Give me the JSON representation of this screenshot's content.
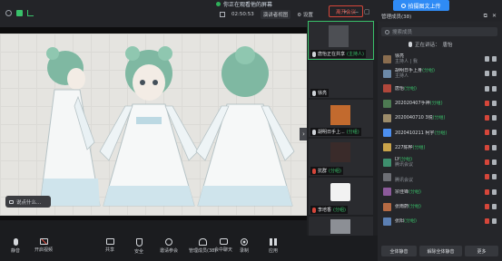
{
  "topbar": {
    "share_banner": "你正在观看他的屏幕",
    "timer": "02:50:53",
    "view_mode": "演讲者视图",
    "settings": "设置"
  },
  "upload_button": "拍摄图文上传",
  "panel_header": {
    "title": "管理成员(38)"
  },
  "stage": {
    "input_placeholder": "说点什么..."
  },
  "videos": [
    {
      "label": "唐怡正在共享",
      "tag": "(主持人)",
      "mic": "on",
      "active": true
    },
    {
      "label": "徐亮",
      "tag": "",
      "mic": "on",
      "active": false
    },
    {
      "label": "胡明日手上...",
      "tag": "(分组)",
      "mic": "on",
      "active": false
    },
    {
      "label": "抗群",
      "tag": "(分组)",
      "mic": "off",
      "active": false
    },
    {
      "label": "李培香",
      "tag": "(分组)",
      "mic": "off",
      "active": false
    },
    {
      "label": "",
      "tag": "",
      "mic": "off",
      "active": false
    }
  ],
  "panel": {
    "search_placeholder": "搜索成员",
    "speaking_label": "正在讲话：",
    "speaking_name": "唐怡",
    "participants": [
      {
        "name": "徐亮",
        "sub": "主持人 | 我",
        "tag": "",
        "color": "#8a6d4f",
        "mic": "on"
      },
      {
        "name": "胡明日手上身",
        "sub": "主持人",
        "tag": "(分组)",
        "color": "#6c89a8",
        "mic": "on"
      },
      {
        "name": "唐怡",
        "sub": "",
        "tag": "(分组)",
        "color": "#b0473b",
        "mic": "on"
      },
      {
        "name": "202020407手神",
        "sub": "",
        "tag": "(分组)",
        "color": "#4d7a52",
        "mic": "off"
      },
      {
        "name": "2020040710 3锐",
        "sub": "",
        "tag": "(分组)",
        "color": "#9d8c6a",
        "mic": "off"
      },
      {
        "name": "2020410211 柯宇",
        "sub": "",
        "tag": "(分组)",
        "color": "#4c8ff0",
        "mic": "off"
      },
      {
        "name": "227陈桦",
        "sub": "",
        "tag": "(分组)",
        "color": "#c9a34a",
        "mic": "off"
      },
      {
        "name": "LY",
        "sub": "腾讯会议",
        "tag": "(分组)",
        "color": "#3e8f6e",
        "mic": "off"
      },
      {
        "name": "",
        "sub": "腾讯会议",
        "tag": "",
        "color": "#6d6f75",
        "mic": "off"
      },
      {
        "name": "宗佳锋",
        "sub": "",
        "tag": "(分组)",
        "color": "#8c5a9b",
        "mic": "off"
      },
      {
        "name": "张雨蔚",
        "sub": "",
        "tag": "(分组)",
        "color": "#b56a43",
        "mic": "off"
      },
      {
        "name": "张阳",
        "sub": "",
        "tag": "(分组)",
        "color": "#5b7fb3",
        "mic": "off"
      }
    ],
    "footer": {
      "mute_all": "全体静音",
      "unmute_all": "解除全体静音",
      "more": "更多"
    }
  },
  "toolbar": {
    "items": [
      {
        "key": "mic",
        "label": "静音",
        "icon": "microphone-icon"
      },
      {
        "key": "video",
        "label": "开启视频",
        "icon": "camera-off-icon"
      },
      {
        "key": "share",
        "label": "共享",
        "icon": "share-screen-icon"
      },
      {
        "key": "security",
        "label": "安全",
        "icon": "shield-icon"
      },
      {
        "key": "invite",
        "label": "邀请参会",
        "icon": "invite-icon"
      },
      {
        "key": "members",
        "label": "管理成员(38)",
        "icon": "members-icon"
      },
      {
        "key": "chat",
        "label": "会中聊天",
        "icon": "chat-icon"
      },
      {
        "key": "record",
        "label": "录制",
        "icon": "record-icon"
      },
      {
        "key": "apps",
        "label": "应用",
        "icon": "apps-icon"
      }
    ],
    "leave": "离开会议"
  },
  "colors": {
    "accent": "#2f8bf5",
    "speaking": "#39c16a",
    "danger": "#d6463a"
  }
}
